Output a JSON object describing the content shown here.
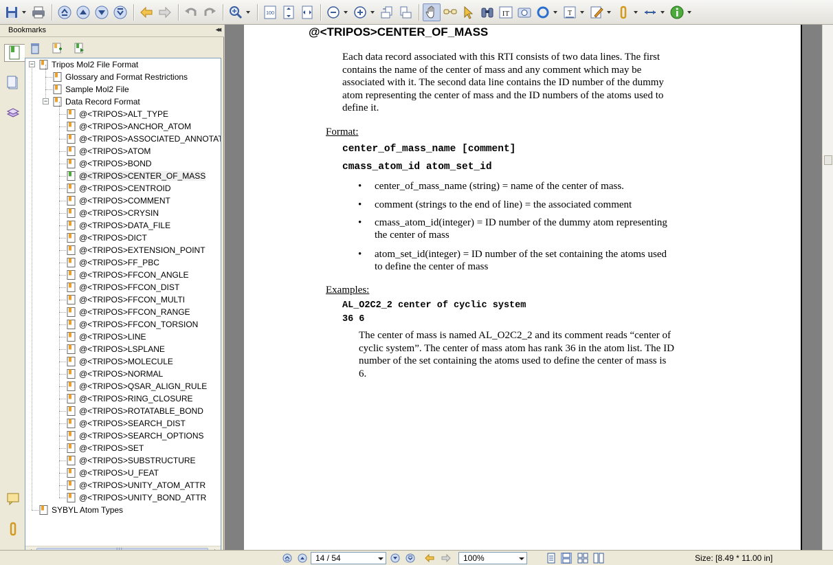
{
  "toolbar": {
    "tools": [
      "save",
      "print",
      "first-page",
      "previous-page",
      "next-page",
      "last-page",
      "go-back",
      "go-forward",
      "undo",
      "redo",
      "zoom-in-tool",
      "actual-size",
      "fit-page",
      "fit-width",
      "zoom-out",
      "zoom-in",
      "rotate-left",
      "rotate-right",
      "hand-tool",
      "text-viewer",
      "select-tool",
      "find",
      "typewriter",
      "snapshot",
      "shapes",
      "form-field",
      "comment",
      "attach",
      "measure",
      "info"
    ],
    "active_tool": "hand-tool"
  },
  "sidebar": {
    "title": "Bookmarks",
    "collapse_label": "◂◂",
    "tree": {
      "root": "Tripos Mol2 File Format",
      "children": [
        "Glossary and Format Restrictions",
        "Sample Mol2 File"
      ],
      "section": "Data Record Format",
      "records": [
        "@<TRIPOS>ALT_TYPE",
        "@<TRIPOS>ANCHOR_ATOM",
        "@<TRIPOS>ASSOCIATED_ANNOTAT",
        "@<TRIPOS>ATOM",
        "@<TRIPOS>BOND",
        "@<TRIPOS>CENTER_OF_MASS",
        "@<TRIPOS>CENTROID",
        "@<TRIPOS>COMMENT",
        "@<TRIPOS>CRYSIN",
        "@<TRIPOS>DATA_FILE",
        "@<TRIPOS>DICT",
        "@<TRIPOS>EXTENSION_POINT",
        "@<TRIPOS>FF_PBC",
        "@<TRIPOS>FFCON_ANGLE",
        "@<TRIPOS>FFCON_DIST",
        "@<TRIPOS>FFCON_MULTI",
        "@<TRIPOS>FFCON_RANGE",
        "@<TRIPOS>FFCON_TORSION",
        "@<TRIPOS>LINE",
        "@<TRIPOS>LSPLANE",
        "@<TRIPOS>MOLECULE",
        "@<TRIPOS>NORMAL",
        "@<TRIPOS>QSAR_ALIGN_RULE",
        "@<TRIPOS>RING_CLOSURE",
        "@<TRIPOS>ROTATABLE_BOND",
        "@<TRIPOS>SEARCH_DIST",
        "@<TRIPOS>SEARCH_OPTIONS",
        "@<TRIPOS>SET",
        "@<TRIPOS>SUBSTRUCTURE",
        "@<TRIPOS>U_FEAT",
        "@<TRIPOS>UNITY_ATOM_ATTR",
        "@<TRIPOS>UNITY_BOND_ATTR"
      ],
      "selected": "@<TRIPOS>CENTER_OF_MASS",
      "last_root": "SYBYL Atom Types"
    },
    "hscroll_grip": "III"
  },
  "document": {
    "heading": "@<TRIPOS>CENTER_OF_MASS",
    "intro_lines": [
      "Each data record associated with this RTI consists of two data lines. The first",
      "contains the name of the center of mass and any comment which may be",
      "associated with it. The second data line contains the ID number of the dummy",
      "atom representing the center of mass and the ID numbers of the atoms used to",
      "define it."
    ],
    "format_label": "Format:",
    "format_lines": [
      "center_of_mass_name [comment]",
      "cmass_atom_id atom_set_id"
    ],
    "bullets": [
      {
        "lines": [
          "center_of_mass_name (string) = name of the center of mass."
        ]
      },
      {
        "lines": [
          "comment (strings to the end of line) = the associated comment"
        ]
      },
      {
        "lines": [
          "cmass_atom_id(integer) = ID number of the dummy atom representing",
          "the center of mass"
        ]
      },
      {
        "lines": [
          "atom_set_id(integer) = ID number of the set containing the atoms used",
          "to define the center of mass"
        ]
      }
    ],
    "bullet_char": "•",
    "examples_label": "Examples:",
    "example_lines": [
      "AL_O2C2_2 center of cyclic system",
      "36 6"
    ],
    "example_desc_lines": [
      "The center of mass is named AL_O2C2_2 and its comment reads “center of",
      "cyclic system”. The center of mass atom has rank 36 in the atom list. The ID",
      "number of the set containing the atoms used to define the center of mass is",
      "6."
    ]
  },
  "statusbar": {
    "page_indicator": "14 / 54",
    "zoom": "100%",
    "size": "Size: [8.49 * 11.00 in]"
  }
}
